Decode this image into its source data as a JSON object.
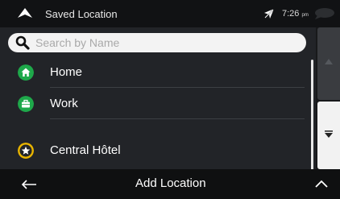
{
  "status_bar": {
    "title": "Saved Location",
    "time": "7:26",
    "ampm": "pm",
    "icons": [
      "navigation-arrow-icon",
      "gps-signal-icon",
      "message-bubble-icon"
    ]
  },
  "search": {
    "placeholder": "Search by Name",
    "value": ""
  },
  "locations": [
    {
      "label": "Home",
      "icon": "home-icon",
      "icon_color": "#1ea84a"
    },
    {
      "label": "Work",
      "icon": "briefcase-icon",
      "icon_color": "#1ea84a"
    },
    {
      "label": "Central Hôtel",
      "icon": "star-icon",
      "icon_color": "#e8b400"
    }
  ],
  "bottom_bar": {
    "add_location": "Add Location",
    "icons": [
      "back-arrow-icon",
      "chevron-up-icon"
    ]
  },
  "colors": {
    "background": "#222428",
    "status_bar": "#111214",
    "accent_green": "#1ea84a",
    "accent_yellow": "#e8b400"
  }
}
